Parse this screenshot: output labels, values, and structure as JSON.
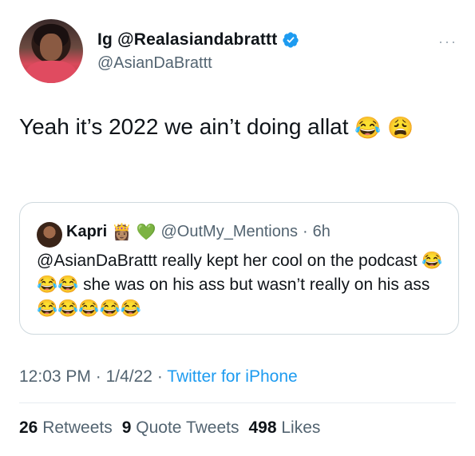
{
  "author": {
    "display_name": "Ig @Realasiandabrattt",
    "handle": "@AsianDaBrattt",
    "verified_icon": "verified-badge-icon",
    "more_icon": "···"
  },
  "tweet": {
    "text": "Yeah it’s 2022 we ain’t doing allat",
    "emoji_1": "😂",
    "emoji_2": "😩"
  },
  "quote": {
    "name": "Kapri",
    "emoji_badges": "👸🏽 💚",
    "handle": "@OutMy_Mentions",
    "sep": "·",
    "time": "6h",
    "text_1": "@AsianDaBrattt really kept her cool on the podcast",
    "emojis_1": "😂😂😂",
    "text_2": "she was on his ass but wasn’t really on his ass",
    "emojis_2": "😂😂😂😂😂"
  },
  "meta": {
    "time": "12:03 PM",
    "date": "1/4/22",
    "sep": "·",
    "source": "Twitter for iPhone"
  },
  "stats": {
    "retweets_count": "26",
    "retweets_label": "Retweets",
    "quotes_count": "9",
    "quotes_label": "Quote Tweets",
    "likes_count": "498",
    "likes_label": "Likes"
  },
  "colors": {
    "accent": "#1d9bf0",
    "secondary_text": "#536471",
    "border": "#cfd9de"
  }
}
